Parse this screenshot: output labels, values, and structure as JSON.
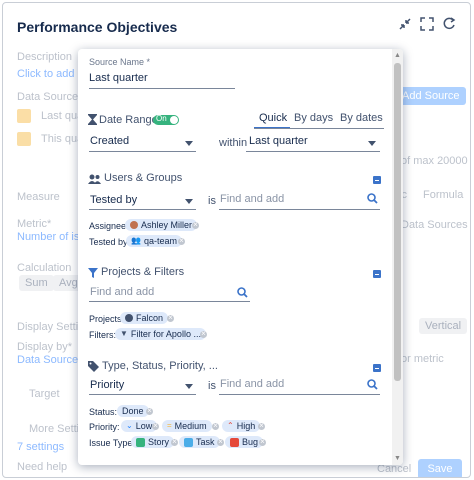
{
  "window": {
    "title": "Performance Objectives"
  },
  "background": {
    "source_name_label": "Description",
    "click_to_add": "Click to add d",
    "data_sources_label": "Data Sources*",
    "source_a": "Last qua",
    "source_b": "This qua",
    "add_source": "Add Source",
    "of_max": "of max 20000",
    "measure_label": "Measure",
    "metric_label": "Metric*",
    "metric_value": "Number of issu",
    "calculation_label": "Calculation",
    "sum_button": "Sum",
    "avg_button": "Avg",
    "display_settings": "Display Setti",
    "display_by": "Display by*",
    "data_sources_link": "Data Source/s",
    "target_label": "Target",
    "more_settings": "More Settings",
    "settings_count": "7 settings",
    "need_help": "Need help",
    "cancel": "Cancel",
    "save": "Save",
    "ic_label": "ic",
    "formula_label": "Formula",
    "data_sources_right": "Data Sources",
    "vertical": "Vertical",
    "or_metric": "or metric"
  },
  "panel": {
    "source_name": {
      "label": "Source Name *",
      "value": "Last quarter"
    },
    "date_range": {
      "label": "Date Range",
      "toggle": "On",
      "tabs": [
        "Quick",
        "By days",
        "By dates"
      ],
      "field": "Created",
      "within": "within",
      "period": "Last quarter"
    },
    "users_groups": {
      "title": "Users & Groups",
      "field": "Tested by",
      "is": "is",
      "placeholder": "Find and add",
      "assignee_label": "Assignee:",
      "assignee_value": "Ashley Miller",
      "tested_label": "Tested by:",
      "tested_value": "qa-team"
    },
    "projects_filters": {
      "title": "Projects & Filters",
      "placeholder": "Find and add",
      "projects_label": "Projects:",
      "project_value": "Falcon",
      "filters_label": "Filters:",
      "filter_value": "Filter for Apollo ..."
    },
    "type_status": {
      "title": "Type, Status, Priority, ...",
      "field": "Priority",
      "is": "is",
      "placeholder": "Find and add",
      "status_label": "Status:",
      "status_value": "Done",
      "priority_label": "Priority:",
      "priorities": [
        "Low",
        "Medium",
        "High"
      ],
      "issue_type_label": "Issue Type:",
      "issue_types": [
        "Story",
        "Task",
        "Bug"
      ]
    }
  },
  "colors": {
    "accent": "#3b73c9",
    "toggle_on": "#36b37e",
    "pill_bg": "#dee9fa"
  }
}
